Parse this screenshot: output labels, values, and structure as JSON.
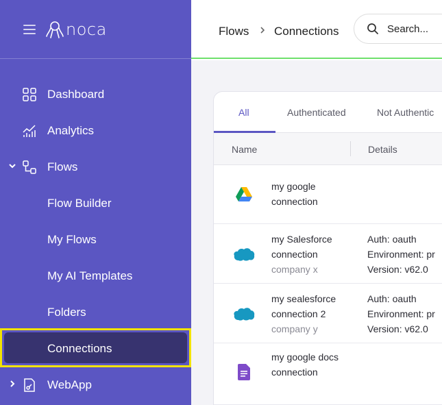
{
  "sidebar": {
    "logo_text": "noca",
    "items": [
      {
        "label": "Dashboard"
      },
      {
        "label": "Analytics"
      },
      {
        "label": "Flows"
      },
      {
        "label": "Flow Builder"
      },
      {
        "label": "My Flows"
      },
      {
        "label": "My AI Templates"
      },
      {
        "label": "Folders"
      },
      {
        "label": "Connections"
      },
      {
        "label": "WebApp"
      }
    ],
    "active_item": "Connections"
  },
  "breadcrumb": {
    "parent": "Flows",
    "current": "Connections"
  },
  "search": {
    "placeholder": "Search..."
  },
  "tabs": [
    {
      "label": "All"
    },
    {
      "label": "Authenticated"
    },
    {
      "label": "Not Authentic"
    }
  ],
  "table": {
    "columns": [
      "Name",
      "Details"
    ],
    "rows": [
      {
        "name": "my google connection",
        "company": "",
        "details": [],
        "icon": "google-drive-icon"
      },
      {
        "name": "my Salesforce connection",
        "company": "company x",
        "details": [
          "Auth: oauth",
          "Environment: pr",
          "Version: v62.0"
        ],
        "icon": "salesforce-icon"
      },
      {
        "name": "my sealesforce connection 2",
        "company": "company y",
        "details": [
          "Auth: oauth",
          "Environment: pr",
          "Version: v62.0"
        ],
        "icon": "salesforce-icon"
      },
      {
        "name": "my google docs connection",
        "company": "",
        "details": [],
        "icon": "google-docs-icon"
      }
    ]
  },
  "colors": {
    "sidebar": "#5b56c2",
    "active": "#37336f",
    "highlight": "#f2e300",
    "accent": "#5b56c2"
  }
}
